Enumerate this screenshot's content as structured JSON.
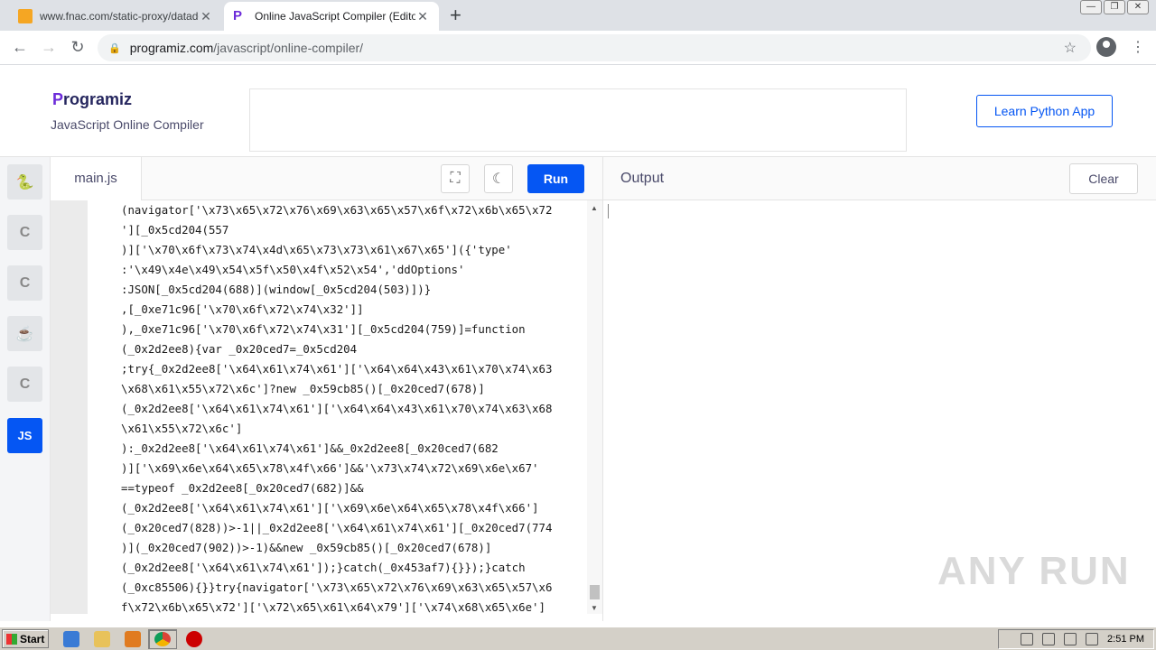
{
  "browser": {
    "tabs": [
      {
        "title": "www.fnac.com/static-proxy/datadom",
        "active": false
      },
      {
        "title": "Online JavaScript Compiler (Editor)",
        "active": true
      }
    ],
    "new_tab": "+",
    "address": {
      "host": "programiz.com",
      "path": "/javascript/online-compiler/"
    }
  },
  "header": {
    "logo_text": "rogramiz",
    "logo_initial": "P",
    "subtitle": "JavaScript Online Compiler",
    "learn_button": "Learn Python App"
  },
  "languages": [
    {
      "name": "python",
      "glyph": "🐍"
    },
    {
      "name": "c",
      "glyph": "C"
    },
    {
      "name": "cpp",
      "glyph": "C"
    },
    {
      "name": "java",
      "glyph": "☕"
    },
    {
      "name": "csharp",
      "glyph": "C"
    },
    {
      "name": "javascript",
      "glyph": "JS",
      "active": true
    }
  ],
  "editor": {
    "file_name": "main.js",
    "run_label": "Run",
    "code_lines": [
      "(navigator['\\x73\\x65\\x72\\x76\\x69\\x63\\x65\\x57\\x6f\\x72\\x6b\\x65\\x72",
      "'][_0x5cd204(557",
      ")]['\\x70\\x6f\\x73\\x74\\x4d\\x65\\x73\\x73\\x61\\x67\\x65']({'type'",
      ":'\\x49\\x4e\\x49\\x54\\x5f\\x50\\x4f\\x52\\x54','ddOptions'",
      ":JSON[_0x5cd204(688)](window[_0x5cd204(503)])}",
      ",[_0xe71c96['\\x70\\x6f\\x72\\x74\\x32']]",
      "),_0xe71c96['\\x70\\x6f\\x72\\x74\\x31'][_0x5cd204(759)]=function",
      "(_0x2d2ee8){var _0x20ced7=_0x5cd204",
      ";try{_0x2d2ee8['\\x64\\x61\\x74\\x61']['\\x64\\x64\\x43\\x61\\x70\\x74\\x63",
      "\\x68\\x61\\x55\\x72\\x6c']?new _0x59cb85()[_0x20ced7(678)]",
      "(_0x2d2ee8['\\x64\\x61\\x74\\x61']['\\x64\\x64\\x43\\x61\\x70\\x74\\x63\\x68",
      "\\x61\\x55\\x72\\x6c']",
      "):_0x2d2ee8['\\x64\\x61\\x74\\x61']&&_0x2d2ee8[_0x20ced7(682",
      ")]['\\x69\\x6e\\x64\\x65\\x78\\x4f\\x66']&&'\\x73\\x74\\x72\\x69\\x6e\\x67'",
      "==typeof _0x2d2ee8[_0x20ced7(682)]&&",
      "(_0x2d2ee8['\\x64\\x61\\x74\\x61']['\\x69\\x6e\\x64\\x65\\x78\\x4f\\x66']",
      "(_0x20ced7(828))>-1||_0x2d2ee8['\\x64\\x61\\x74\\x61'][_0x20ced7(774",
      ")](_0x20ced7(902))>-1)&&new _0x59cb85()[_0x20ced7(678)]",
      "(_0x2d2ee8['\\x64\\x61\\x74\\x61']);}catch(_0x453af7){}});}catch",
      "(_0xc85506){}}try{navigator['\\x73\\x65\\x72\\x76\\x69\\x63\\x65\\x57\\x6",
      "f\\x72\\x6b\\x65\\x72']['\\x72\\x65\\x61\\x64\\x79']['\\x74\\x68\\x65\\x6e']"
    ]
  },
  "output": {
    "label": "Output",
    "clear_label": "Clear"
  },
  "watermark": "ANY RUN",
  "taskbar": {
    "start_label": "Start",
    "clock": "2:51 PM"
  }
}
